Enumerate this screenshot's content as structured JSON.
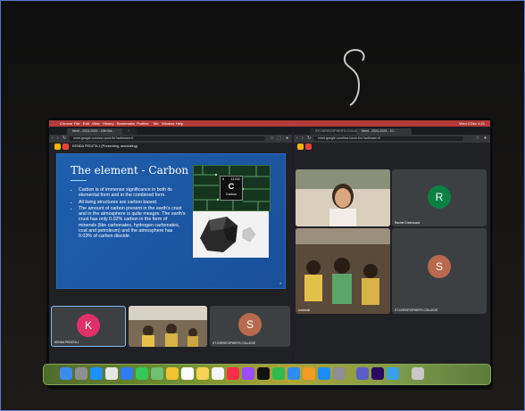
{
  "menubar": {
    "items": [
      "Chrome",
      "File",
      "Edit",
      "View",
      "History",
      "Bookmarks",
      "Profiles",
      "Tab",
      "Window",
      "Help"
    ],
    "right": "Wed 4 Dec 4:21"
  },
  "left_window": {
    "tab_title": "Meet - 2024-2025 - 10th Bd...",
    "url": "meet.google.com/xxv-rpcd-ffv?authuser=0",
    "presenting_label": "KENDA PEDZTA J (Presenting, annotating)",
    "slide": {
      "title": "The element - Carbon",
      "bullets": [
        "Carbon is of immense significance in both its elemental form and in the combined form.",
        "All living structures are carbon based.",
        "The amount of carbon present in the earth's crust and in the atmosphere is quite meagre. The earth's crust has only 0.02% carbon in the form of minerals (like carbonates, hydrogen carbonates, coal and petroleum) and the atmosphere has 0.03% of carbon dioxide."
      ],
      "element": {
        "number": "6",
        "mass": "12.011",
        "symbol": "C",
        "name": "Carbon"
      },
      "slide_number": "4"
    },
    "tiles": [
      {
        "initial": "K",
        "name": "KENDA PEDZTA J"
      },
      {
        "initial": "",
        "name": ""
      },
      {
        "initial": "S",
        "name": "ST.CHRISTOPHER'S COLLEGE"
      }
    ],
    "control_label": "2024-2025 | 10th Bd Class - 5..."
  },
  "right_window": {
    "tab_title": "ST.CHRISTOPHER'S COLLEGE",
    "tab2_title": "Meet - 2024-2025 - 10...",
    "url": "meet.google.com/bvs-hxxm-fvs?authuser=0",
    "tiles": [
      {
        "initial": "",
        "name": ""
      },
      {
        "initial": "R",
        "name": "Rachel Greenwood"
      },
      {
        "initial": "",
        "name": "codesmit"
      },
      {
        "initial": "S",
        "name": "ST.CHRISTOPHER'S COLLEGE"
      }
    ],
    "control_label": "2024-..."
  },
  "colors": {
    "avatar_k": "#e0306a",
    "avatar_r": "#0b8043",
    "avatar_s": "#b86a4e",
    "slide_bg": "#1e5fae",
    "end_call": "#ea4335",
    "menubar": "#b23a3a"
  },
  "dock": {
    "icons": [
      "finder-icon",
      "launchpad-icon",
      "safari-icon",
      "chrome-icon",
      "mail-icon",
      "facetime-icon",
      "maps-icon",
      "photos-icon",
      "calendar-icon",
      "notes-icon",
      "reminders-icon",
      "music-icon",
      "podcasts-icon",
      "tv-icon",
      "numbers-icon",
      "keynote-icon",
      "pages-icon",
      "appstore-icon",
      "settings-icon",
      "teams-icon",
      "premiere-icon",
      "preview-icon",
      "trash-icon"
    ]
  }
}
